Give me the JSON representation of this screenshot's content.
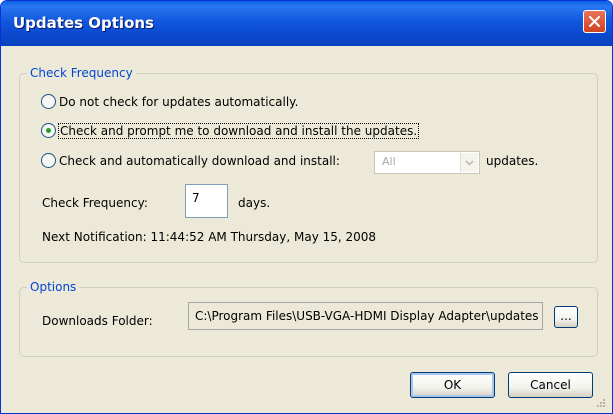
{
  "dialog": {
    "title": "Updates Options",
    "close_icon": "close-x-icon"
  },
  "check_frequency_group": {
    "legend": "Check Frequency",
    "options": [
      {
        "label": "Do not check for updates automatically.",
        "selected": false
      },
      {
        "label": "Check and prompt me to download and install the updates.",
        "selected": true
      },
      {
        "label": "Check and automatically download and install:",
        "selected": false
      }
    ],
    "updates_filter": {
      "value": "All",
      "enabled": false
    },
    "updates_suffix": "updates.",
    "frequency_label": "Check Frequency:",
    "frequency_value": "7",
    "frequency_unit": "days.",
    "next_notification": "Next Notification: 11:44:52 AM Thursday, May 15, 2008"
  },
  "options_group": {
    "legend": "Options",
    "downloads_folder_label": "Downloads Folder:",
    "downloads_folder_value": "C:\\Program Files\\USB-VGA-HDMI Display Adapter\\updates",
    "browse_label": "..."
  },
  "buttons": {
    "ok": "OK",
    "cancel": "Cancel"
  },
  "colors": {
    "titlebar": "#0a4fd6",
    "group_legend": "#0046d5",
    "dialog_face": "#ece9d8",
    "close_button": "#d1421f"
  }
}
